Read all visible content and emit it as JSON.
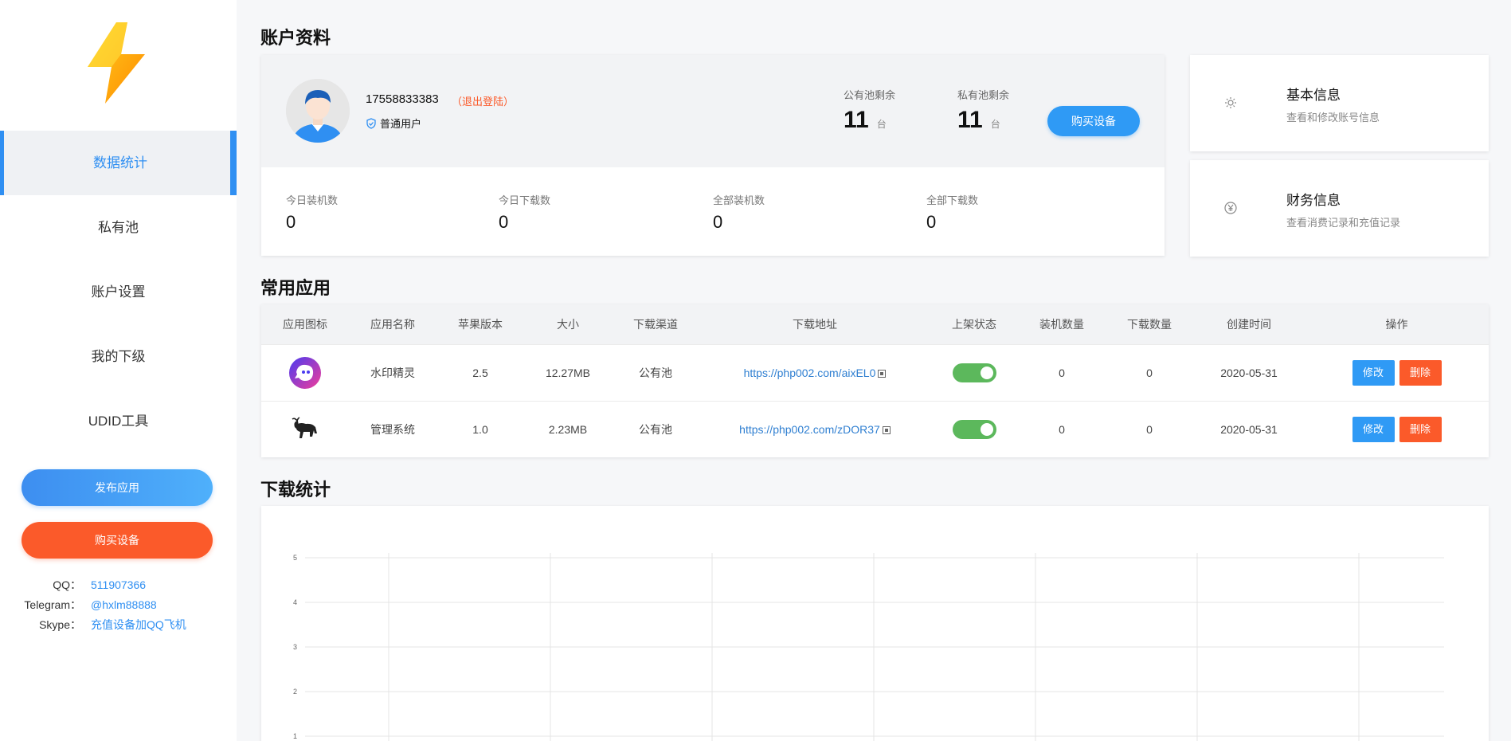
{
  "sidebar": {
    "nav": [
      {
        "label": "数据统计",
        "active": true
      },
      {
        "label": "私有池",
        "active": false
      },
      {
        "label": "账户设置",
        "active": false
      },
      {
        "label": "我的下级",
        "active": false
      },
      {
        "label": "UDID工具",
        "active": false
      }
    ],
    "publish_label": "发布应用",
    "buy_label": "购买设备",
    "contacts": [
      {
        "key": "QQ：",
        "value": "511907366"
      },
      {
        "key": "Telegram：",
        "value": "@hxlm88888"
      },
      {
        "key": "Skype：",
        "value": "充值设备加QQ飞机"
      }
    ]
  },
  "account": {
    "section_title": "账户资料",
    "phone": "17558833383",
    "logout_label": "（退出登陆）",
    "user_type": "普通用户",
    "public_pool_label": "公有池剩余",
    "public_pool_value": "11",
    "private_pool_label": "私有池剩余",
    "private_pool_value": "11",
    "unit": "台",
    "buy_device_label": "购买设备",
    "stats": [
      {
        "label": "今日装机数",
        "value": "0"
      },
      {
        "label": "今日下载数",
        "value": "0"
      },
      {
        "label": "全部装机数",
        "value": "0"
      },
      {
        "label": "全部下载数",
        "value": "0"
      }
    ]
  },
  "info_cards": [
    {
      "title": "基本信息",
      "subtitle": "查看和修改账号信息",
      "icon": "gear-icon"
    },
    {
      "title": "财务信息",
      "subtitle": "查看消费记录和充值记录",
      "icon": "yen-icon"
    }
  ],
  "apps": {
    "section_title": "常用应用",
    "headers": [
      "应用图标",
      "应用名称",
      "苹果版本",
      "大小",
      "下载渠道",
      "下载地址",
      "上架状态",
      "装机数量",
      "下载数量",
      "创建时间",
      "操作"
    ],
    "rows": [
      {
        "name": "水印精灵",
        "version": "2.5",
        "size": "12.27MB",
        "channel": "公有池",
        "url": "https://php002.com/aixEL0",
        "status_on": true,
        "installs": "0",
        "downloads": "0",
        "created": "2020-05-31",
        "edit": "修改",
        "delete": "删除"
      },
      {
        "name": "管理系统",
        "version": "1.0",
        "size": "2.23MB",
        "channel": "公有池",
        "url": "https://php002.com/zDOR37",
        "status_on": true,
        "installs": "0",
        "downloads": "0",
        "created": "2020-05-31",
        "edit": "修改",
        "delete": "删除"
      }
    ]
  },
  "downloads": {
    "section_title": "下载统计"
  },
  "chart_data": {
    "type": "line",
    "title": "",
    "ylim": [
      0,
      5
    ],
    "yticks": [
      "5",
      "4",
      "3",
      "2",
      "1"
    ],
    "grid": true,
    "series": []
  }
}
